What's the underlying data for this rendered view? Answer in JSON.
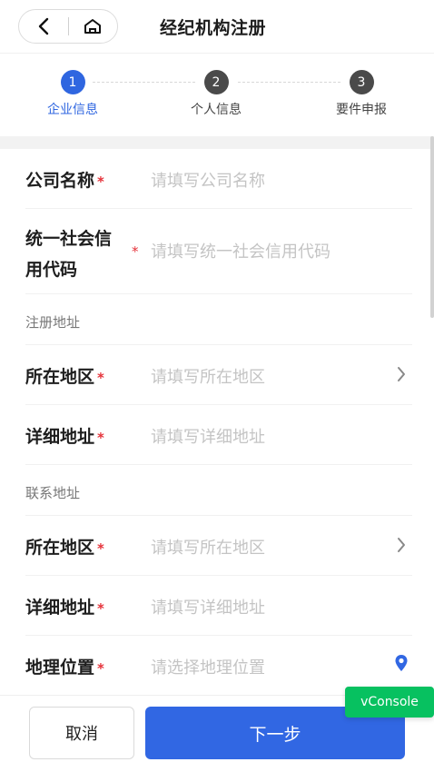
{
  "header": {
    "title": "经纪机构注册"
  },
  "steps": [
    {
      "num": "1",
      "label": "企业信息",
      "active": true
    },
    {
      "num": "2",
      "label": "个人信息",
      "active": false
    },
    {
      "num": "3",
      "label": "要件申报",
      "active": false
    }
  ],
  "form": {
    "company_name": {
      "label": "公司名称",
      "placeholder": "请填写公司名称"
    },
    "credit_code": {
      "label": "统一社会信用代码",
      "placeholder": "请填写统一社会信用代码"
    },
    "reg_section": "注册地址",
    "reg_region": {
      "label": "所在地区",
      "placeholder": "请填写所在地区"
    },
    "reg_detail": {
      "label": "详细地址",
      "placeholder": "请填写详细地址"
    },
    "contact_section": "联系地址",
    "contact_region": {
      "label": "所在地区",
      "placeholder": "请填写所在地区"
    },
    "contact_detail": {
      "label": "详细地址",
      "placeholder": "请填写详细地址"
    },
    "geo": {
      "label": "地理位置",
      "placeholder": "请选择地理位置"
    },
    "required_mark": "*"
  },
  "footer": {
    "cancel_label": "取消",
    "next_label": "下一步"
  },
  "vconsole_label": "vConsole",
  "colors": {
    "primary": "#3167e3",
    "required": "#e5323a",
    "vconsole": "#07c160"
  }
}
